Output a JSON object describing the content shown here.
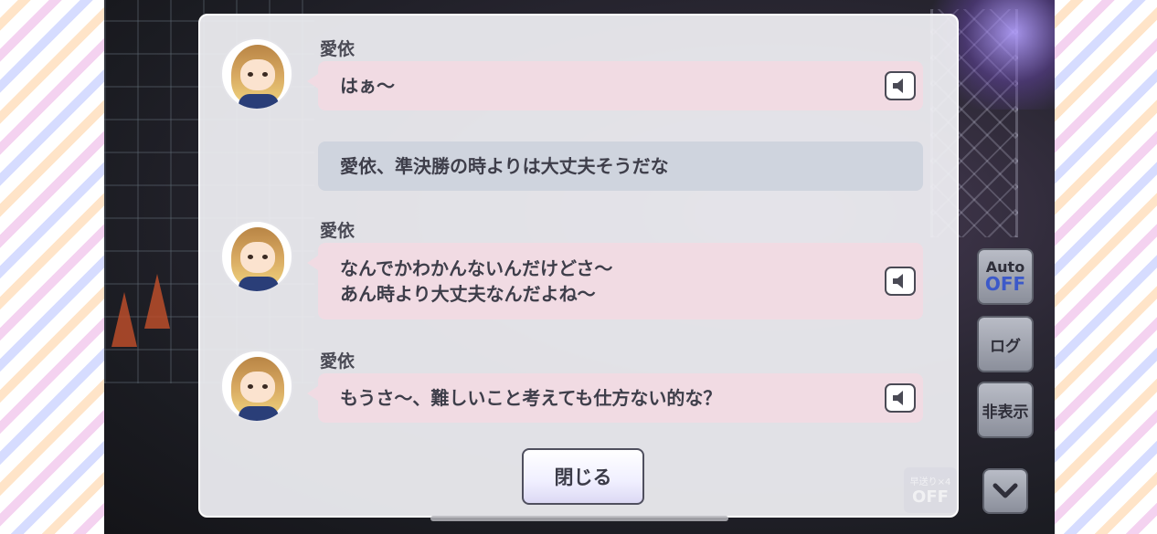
{
  "log_entries": [
    {
      "type": "character",
      "speaker": "愛依",
      "text": "はぁ〜",
      "has_voice": true
    },
    {
      "type": "player",
      "text": "愛依、準決勝の時よりは大丈夫そうだな"
    },
    {
      "type": "character",
      "speaker": "愛依",
      "text": "なんでかわかんないんだけどさ〜\nあん時より大丈夫なんだよね〜",
      "has_voice": true
    },
    {
      "type": "character",
      "speaker": "愛依",
      "text": "もうさ〜、難しいこと考えても仕方ない的な？",
      "has_voice": true
    }
  ],
  "close_button": {
    "label": "閉じる"
  },
  "side_controls": {
    "auto": {
      "label": "Auto",
      "state": "OFF"
    },
    "log": {
      "label": "ログ"
    },
    "hide": {
      "label": "非表示"
    },
    "scroll_down_icon": "chevron-down-icon"
  },
  "skip": {
    "label": "早送り×4",
    "state": "OFF"
  },
  "colors": {
    "character_bubble": "#f1dbe3",
    "player_bubble": "#cfd4de",
    "auto_off_text": "#3c59c9"
  }
}
